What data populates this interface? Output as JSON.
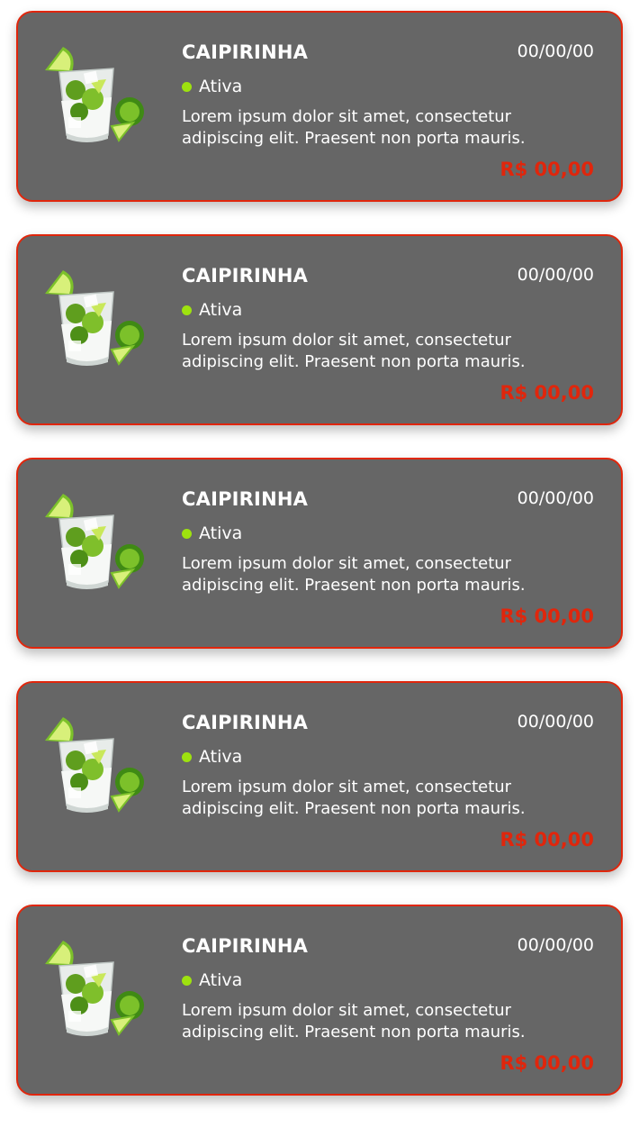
{
  "colors": {
    "card_background": "#666666",
    "card_border": "#e0260c",
    "price": "#e0260c",
    "status_active": "#9ee20f",
    "text": "#ffffff"
  },
  "items": [
    {
      "title": "CAIPIRINHA",
      "date": "00/00/00",
      "status": "Ativa",
      "description": "Lorem ipsum dolor sit amet, consectetur adipiscing elit. Praesent non porta mauris.",
      "price": "R$ 00,00",
      "icon": "caipirinha-drink-icon"
    },
    {
      "title": "CAIPIRINHA",
      "date": "00/00/00",
      "status": "Ativa",
      "description": "Lorem ipsum dolor sit amet, consectetur adipiscing elit. Praesent non porta mauris.",
      "price": "R$ 00,00",
      "icon": "caipirinha-drink-icon"
    },
    {
      "title": "CAIPIRINHA",
      "date": "00/00/00",
      "status": "Ativa",
      "description": "Lorem ipsum dolor sit amet, consectetur adipiscing elit. Praesent non porta mauris.",
      "price": "R$ 00,00",
      "icon": "caipirinha-drink-icon"
    },
    {
      "title": "CAIPIRINHA",
      "date": "00/00/00",
      "status": "Ativa",
      "description": "Lorem ipsum dolor sit amet, consectetur adipiscing elit. Praesent non porta mauris.",
      "price": "R$ 00,00",
      "icon": "caipirinha-drink-icon"
    },
    {
      "title": "CAIPIRINHA",
      "date": "00/00/00",
      "status": "Ativa",
      "description": "Lorem ipsum dolor sit amet, consectetur adipiscing elit. Praesent non porta mauris.",
      "price": "R$ 00,00",
      "icon": "caipirinha-drink-icon"
    }
  ]
}
